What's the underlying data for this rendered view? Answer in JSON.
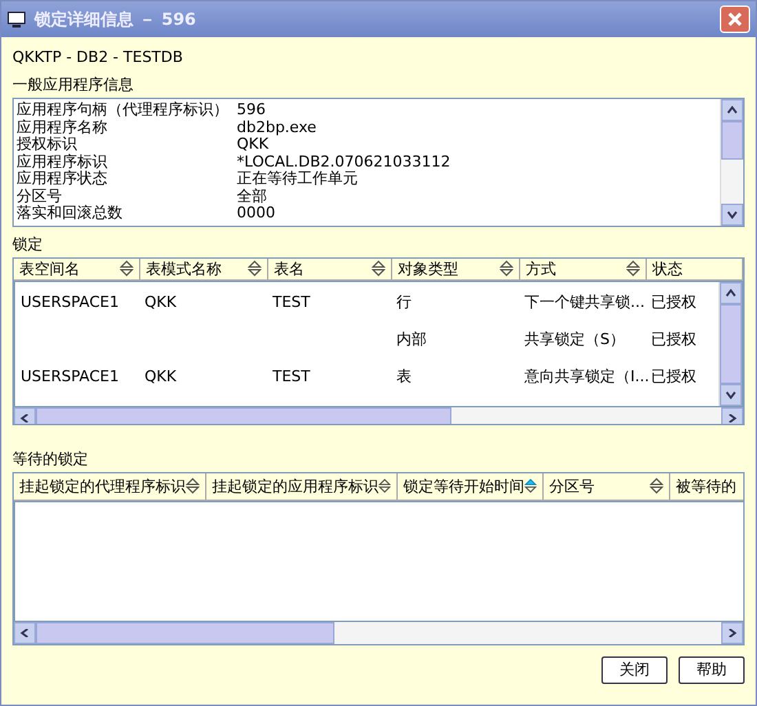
{
  "window": {
    "title": "锁定详细信息 － 596"
  },
  "subtitle": "QKKTP - DB2 - TESTDB",
  "general": {
    "label": "一般应用程序信息",
    "rows": [
      {
        "name": "应用程序句柄（代理程序标识）",
        "value": "596"
      },
      {
        "name": "应用程序名称",
        "value": "db2bp.exe"
      },
      {
        "name": "授权标识",
        "value": "QKK"
      },
      {
        "name": "应用程序标识",
        "value": "*LOCAL.DB2.070621033112"
      },
      {
        "name": "应用程序状态",
        "value": "正在等待工作单元"
      },
      {
        "name": "分区号",
        "value": "全部"
      },
      {
        "name": "落实和回滚总数",
        "value": "0000"
      }
    ]
  },
  "locks": {
    "label": "锁定",
    "columns": [
      {
        "label": "表空间名",
        "sorted": false
      },
      {
        "label": "表模式名称",
        "sorted": false
      },
      {
        "label": "表名",
        "sorted": false
      },
      {
        "label": "对象类型",
        "sorted": false
      },
      {
        "label": "方式",
        "sorted": false
      },
      {
        "label": "状态"
      }
    ],
    "rows": [
      [
        "USERSPACE1",
        "QKK",
        "TEST",
        "行",
        "下一个键共享锁...",
        "已授权"
      ],
      [
        "",
        "",
        "",
        "内部",
        "共享锁定（S）",
        "已授权"
      ],
      [
        "USERSPACE1",
        "QKK",
        "TEST",
        "表",
        "意向共享锁定（I...",
        "已授权"
      ]
    ]
  },
  "waiting": {
    "label": "等待的锁定",
    "columns": [
      {
        "label": "挂起锁定的代理程序标识",
        "sorted": false
      },
      {
        "label": "挂起锁定的应用程序标识",
        "sorted": false
      },
      {
        "label": "锁定等待开始时间",
        "sorted": true
      },
      {
        "label": "分区号",
        "sorted": false
      },
      {
        "label": "被等待的"
      }
    ]
  },
  "buttons": [
    "关闭",
    "帮助"
  ]
}
